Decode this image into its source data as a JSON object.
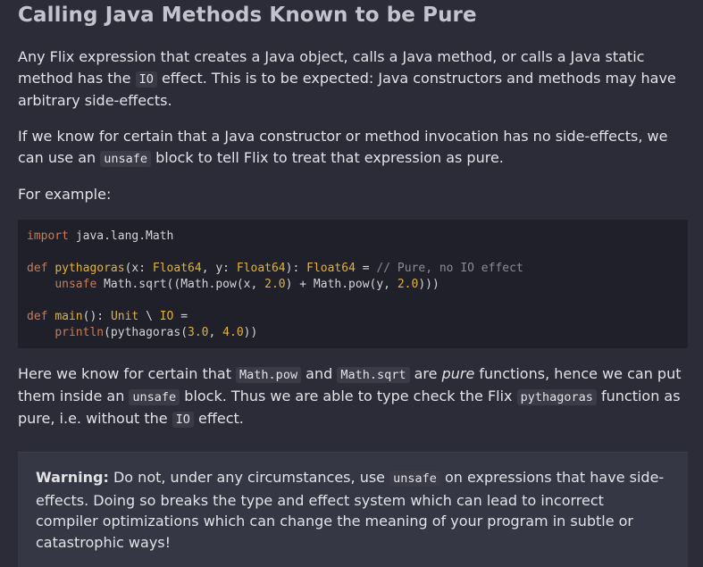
{
  "heading": "Calling Java Methods Known to be Pure",
  "para1": {
    "a": "Any Flix expression that creates a Java object, calls a Java method, or calls a Java static method has the ",
    "code": "IO",
    "b": " effect. This is to be expected: Java constructors and methods may have arbitrary side-effects."
  },
  "para2": {
    "a": "If we know for certain that a Java constructor or method invocation has no side-effects, we can use an ",
    "code": "unsafe",
    "b": " block to tell Flix to treat that expression as pure."
  },
  "para3": "For example:",
  "code_block": {
    "l1_kw": "import",
    "l1_rest": " java.lang.Math",
    "l3_kw": "def",
    "l3_fn": "pythagoras",
    "l3_a": "(x: ",
    "l3_t1": "Float64",
    "l3_b": ", y: ",
    "l3_t2": "Float64",
    "l3_c": "): ",
    "l3_t3": "Float64",
    "l3_d": " = ",
    "l3_comment": "// Pure, no IO effect",
    "l4_indent": "    ",
    "l4_kw": "unsafe",
    "l4_a": " Math.sqrt((Math.pow(x, ",
    "l4_n1": "2.0",
    "l4_b": ") + Math.pow(y, ",
    "l4_n2": "2.0",
    "l4_c": ")))",
    "l6_kw": "def",
    "l6_fn": "main",
    "l6_a": "(): ",
    "l6_t1": "Unit",
    "l6_b": " \\ ",
    "l6_t2": "IO",
    "l6_c": " =",
    "l7_indent": "    ",
    "l7_fn": "println",
    "l7_a": "(pythagoras(",
    "l7_n1": "3.0",
    "l7_b": ", ",
    "l7_n2": "4.0",
    "l7_c": "))"
  },
  "para4": {
    "a": "Here we know for certain that ",
    "code1": "Math.pow",
    "b": " and ",
    "code2": "Math.sqrt",
    "c": " are ",
    "em": "pure",
    "d": " functions, hence we can put them inside an ",
    "code3": "unsafe",
    "e": " block. Thus we are able to type check the Flix ",
    "code4": "pythagoras",
    "f": " function as pure, i.e. without the ",
    "code5": "IO",
    "g": " effect."
  },
  "warning": {
    "label": "Warning:",
    "a": " Do not, under any circumstances, use ",
    "code": "unsafe",
    "b": " on expressions that have side-effects. Doing so breaks the type and effect system which can lead to incorrect compiler optimizations which can change the meaning of your program in subtle or catastrophic ways!"
  }
}
